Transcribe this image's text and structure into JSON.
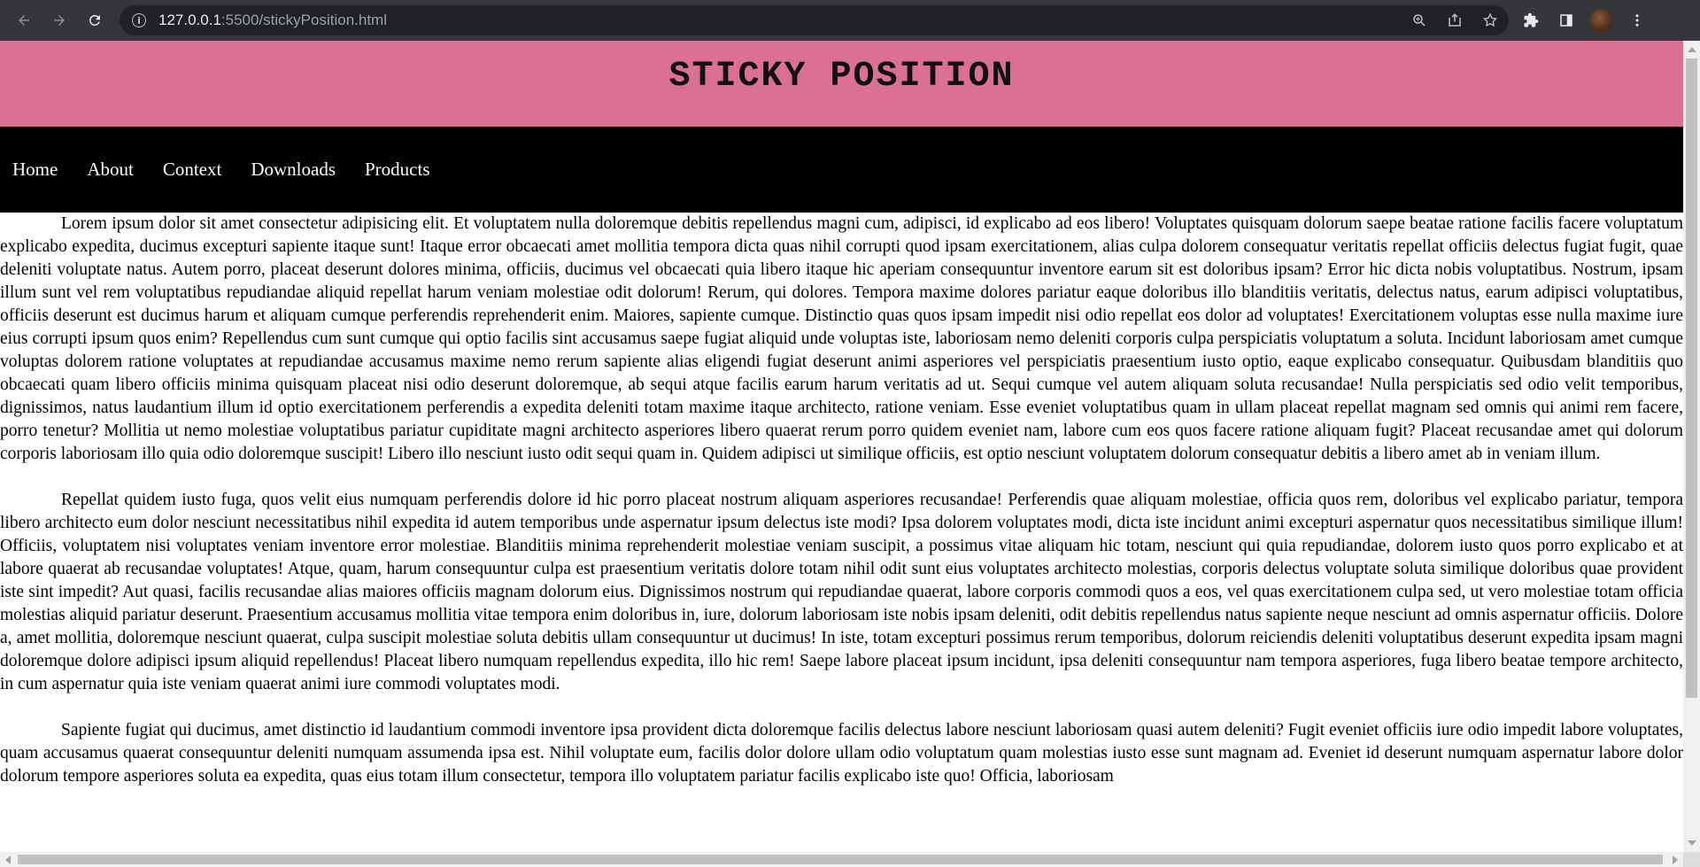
{
  "browser": {
    "url_host": "127.0.0.1",
    "url_path": ":5500/stickyPosition.html"
  },
  "page": {
    "title": "STICKY POSITION",
    "nav": [
      "Home",
      "About",
      "Context",
      "Downloads",
      "Products"
    ],
    "paragraphs": [
      "Lorem ipsum dolor sit amet consectetur adipisicing elit. Et voluptatem nulla doloremque debitis repellendus magni cum, adipisci, id explicabo ad eos libero! Voluptates quisquam dolorum saepe beatae ratione facilis facere voluptatum explicabo expedita, ducimus excepturi sapiente itaque sunt! Itaque error obcaecati amet mollitia tempora dicta quas nihil corrupti quod ipsam exercitationem, alias culpa dolorem consequatur veritatis repellat officiis delectus fugiat fugit, quae deleniti voluptate natus. Autem porro, placeat deserunt dolores minima, officiis, ducimus vel obcaecati quia libero itaque hic aperiam consequuntur inventore earum sit est doloribus ipsam? Error hic dicta nobis voluptatibus. Nostrum, ipsam illum sunt vel rem voluptatibus repudiandae aliquid repellat harum veniam molestiae odit dolorum! Rerum, qui dolores. Tempora maxime dolores pariatur eaque doloribus illo blanditiis veritatis, delectus natus, earum adipisci voluptatibus, officiis deserunt est ducimus harum et aliquam cumque perferendis reprehenderit enim. Maiores, sapiente cumque. Distinctio quas quos ipsam impedit nisi odio repellat eos dolor ad voluptates! Exercitationem voluptas esse nulla maxime iure eius corrupti ipsum quos enim? Repellendus cum sunt cumque qui optio facilis sint accusamus saepe fugiat aliquid unde voluptas iste, laboriosam nemo deleniti corporis culpa perspiciatis voluptatum a soluta. Incidunt laboriosam amet cumque voluptas dolorem ratione voluptates at repudiandae accusamus maxime nemo rerum sapiente alias eligendi fugiat deserunt animi asperiores vel perspiciatis praesentium iusto optio, eaque explicabo consequatur. Quibusdam blanditiis quo obcaecati quam libero officiis minima quisquam placeat nisi odio deserunt doloremque, ab sequi atque facilis earum harum veritatis ad ut. Sequi cumque vel autem aliquam soluta recusandae! Nulla perspiciatis sed odio velit temporibus, dignissimos, natus laudantium illum id optio exercitationem perferendis a expedita deleniti totam maxime itaque architecto, ratione veniam. Esse eveniet voluptatibus quam in ullam placeat repellat magnam sed omnis qui animi rem facere, porro tenetur? Mollitia ut nemo molestiae voluptatibus pariatur cupiditate magni architecto asperiores libero quaerat rerum porro quidem eveniet nam, labore cum eos quos facere ratione aliquam fugit? Placeat recusandae amet qui dolorum corporis laboriosam illo quia odio doloremque suscipit! Libero illo nesciunt iusto odit sequi quam in. Quidem adipisci ut similique officiis, est optio nesciunt voluptatem dolorum consequatur debitis a libero amet ab in veniam illum.",
      "Repellat quidem iusto fuga, quos velit eius numquam perferendis dolore id hic porro placeat nostrum aliquam asperiores recusandae! Perferendis quae aliquam molestiae, officia quos rem, doloribus vel explicabo pariatur, tempora libero architecto eum dolor nesciunt necessitatibus nihil expedita id autem temporibus unde aspernatur ipsum delectus iste modi? Ipsa dolorem voluptates modi, dicta iste incidunt animi excepturi aspernatur quos necessitatibus similique illum! Officiis, voluptatem nisi voluptates veniam inventore error molestiae. Blanditiis minima reprehenderit molestiae veniam suscipit, a possimus vitae aliquam hic totam, nesciunt qui quia repudiandae, dolorem iusto quos porro explicabo et at labore quaerat ab recusandae voluptates! Atque, quam, harum consequuntur culpa est praesentium veritatis dolore totam nihil odit sunt eius voluptates architecto molestias, corporis delectus voluptate soluta similique doloribus quae provident iste sint impedit? Aut quasi, facilis recusandae alias maiores officiis magnam dolorum eius. Dignissimos nostrum qui repudiandae quaerat, labore corporis commodi quos a eos, vel quas exercitationem culpa sed, ut vero molestiae totam officia molestias aliquid pariatur deserunt. Praesentium accusamus mollitia vitae tempora enim doloribus in, iure, dolorum laboriosam iste nobis ipsam deleniti, odit debitis repellendus natus sapiente neque nesciunt ad omnis aspernatur officiis. Dolore a, amet mollitia, doloremque nesciunt quaerat, culpa suscipit molestiae soluta debitis ullam consequuntur ut ducimus! In iste, totam excepturi possimus rerum temporibus, dolorum reiciendis deleniti voluptatibus deserunt expedita ipsam magni doloremque dolore adipisci ipsum aliquid repellendus! Placeat libero numquam repellendus expedita, illo hic rem! Saepe labore placeat ipsum incidunt, ipsa deleniti consequuntur nam tempora asperiores, fuga libero beatae tempore architecto, in cum aspernatur quia iste veniam quaerat animi iure commodi voluptates modi.",
      "Sapiente fugiat qui ducimus, amet distinctio id laudantium commodi inventore ipsa provident dicta doloremque facilis delectus labore nesciunt laboriosam quasi autem deleniti? Fugit eveniet officiis iure odio impedit labore voluptates, quam accusamus quaerat consequuntur deleniti numquam assumenda ipsa est. Nihil voluptate eum, facilis dolor dolore ullam odio voluptatum quam molestias iusto esse sunt magnam ad. Eveniet id deserunt numquam aspernatur labore dolor dolorum tempore asperiores soluta ea expedita, quas eius totam illum consectetur, tempora illo voluptatem pariatur facilis explicabo iste quo! Officia, laboriosam"
    ]
  },
  "icons": {
    "back": "arrow-left-icon",
    "forward": "arrow-right-icon",
    "reload": "reload-icon",
    "info": "info-icon",
    "zoom": "zoom-icon",
    "share": "share-icon",
    "bookmark": "star-icon",
    "extensions": "puzzle-icon",
    "sidepanel": "side-panel-icon",
    "menu": "kebab-menu-icon"
  },
  "colors": {
    "header_bg": "#db7093",
    "navbar_bg": "#000000",
    "chrome_bg": "#35363a",
    "omnibox_bg": "#202124"
  }
}
